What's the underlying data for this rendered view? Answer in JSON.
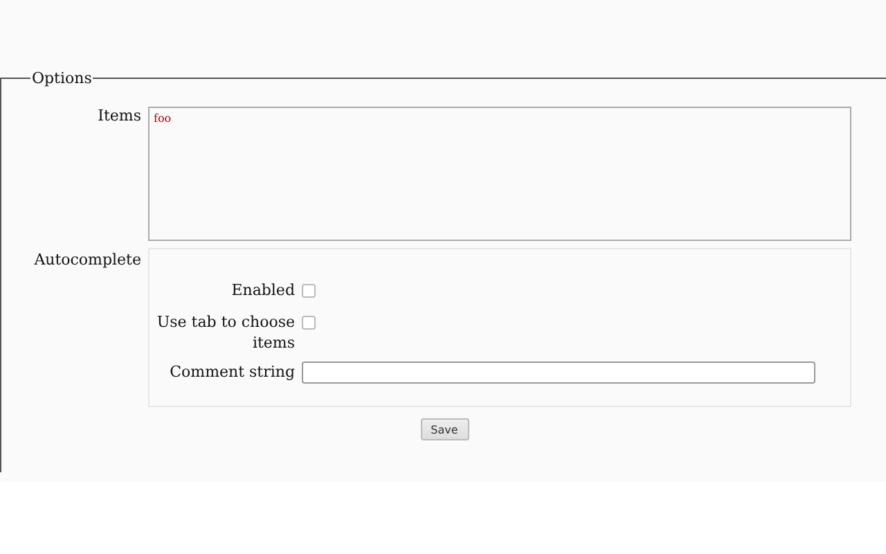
{
  "fieldset": {
    "legend": "Options"
  },
  "items": {
    "label": "Items",
    "value": "foo"
  },
  "autocomplete": {
    "label": "Autocomplete",
    "fields": [
      {
        "kind": "checkbox",
        "label": "Enabled",
        "checked": false
      },
      {
        "kind": "checkbox",
        "label": "Use tab to choose items",
        "checked": false
      },
      {
        "kind": "text",
        "label": "Comment string"
      }
    ]
  },
  "buttons": [
    {
      "label": "Save"
    }
  ]
}
